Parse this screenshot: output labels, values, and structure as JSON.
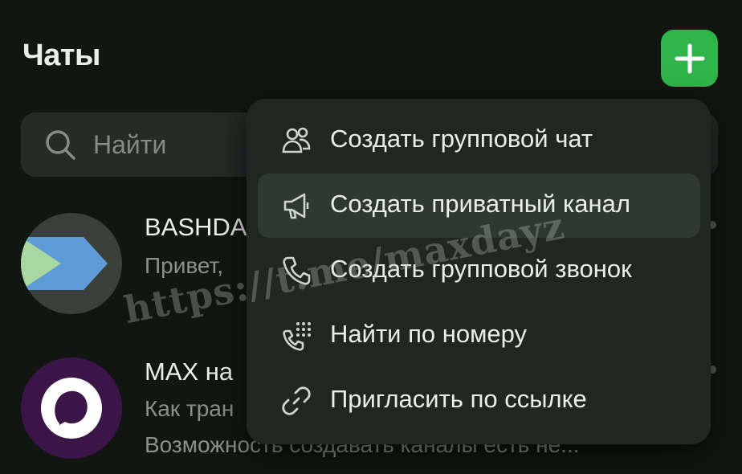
{
  "header": {
    "title": "Чаты"
  },
  "search": {
    "placeholder": "Найти"
  },
  "chats": [
    {
      "title": "BASHDA",
      "subtitle": "Привет, "
    },
    {
      "title": "MAX на",
      "subtitle": "Как тран",
      "subtitle2": "Возможность создавать каналы есть не..."
    }
  ],
  "menu": {
    "items": [
      {
        "label": "Создать групповой чат",
        "icon": "group-icon"
      },
      {
        "label": "Создать приватный канал",
        "icon": "megaphone-icon"
      },
      {
        "label": "Создать групповой звонок",
        "icon": "phone-icon"
      },
      {
        "label": "Найти по номеру",
        "icon": "dialpad-phone-icon"
      },
      {
        "label": "Пригласить по ссылке",
        "icon": "link-icon"
      }
    ]
  },
  "watermark": "https://t.me/maxdayz",
  "colors": {
    "accent": "#2fb54a",
    "background": "#121612",
    "menu": "#202621",
    "highlight": "#2e3a30"
  }
}
